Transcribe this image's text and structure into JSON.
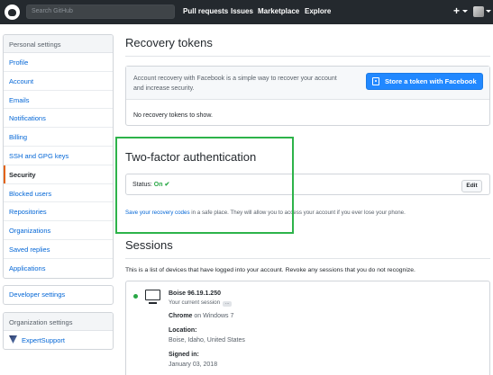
{
  "header": {
    "search_placeholder": "Search GitHub",
    "nav": [
      "Pull requests",
      "Issues",
      "Marketplace",
      "Explore"
    ],
    "plus": "+"
  },
  "sidebar": {
    "personal_heading": "Personal settings",
    "items": [
      {
        "label": "Profile"
      },
      {
        "label": "Account"
      },
      {
        "label": "Emails"
      },
      {
        "label": "Notifications"
      },
      {
        "label": "Billing"
      },
      {
        "label": "SSH and GPG keys"
      },
      {
        "label": "Security",
        "selected": true
      },
      {
        "label": "Blocked users"
      },
      {
        "label": "Repositories"
      },
      {
        "label": "Organizations"
      },
      {
        "label": "Saved replies"
      },
      {
        "label": "Applications"
      }
    ],
    "developer_settings": "Developer settings",
    "org_heading": "Organization settings",
    "org_item": "ExpertSupport"
  },
  "recovery": {
    "title": "Recovery tokens",
    "desc_line1": "Account recovery with Facebook is a simple way to recover your account",
    "desc_line2": "and increase security.",
    "button": "Store a token with Facebook",
    "empty": "No recovery tokens to show."
  },
  "two_factor": {
    "title": "Two-factor authentication",
    "status_label": "Status:",
    "status_value": "On",
    "check": "✔",
    "edit": "Edit",
    "codes_link": "Save your recovery codes",
    "codes_rest": " in a safe place. They will allow you to access your account if you ever lose your phone."
  },
  "sessions": {
    "title": "Sessions",
    "desc": "This is a list of devices that have logged into your account. Revoke any sessions that you do not recognize.",
    "session": {
      "location_ip": "Boise 96.19.1.250",
      "current": "Your current session",
      "more": "…",
      "browser": "Chrome",
      "os_text": " on Windows 7",
      "location_label": "Location:",
      "location_value": "Boise, Idaho, United States",
      "signed_label": "Signed in:",
      "signed_value": "January 03, 2018"
    }
  },
  "colors": {
    "header_bg": "#24292e",
    "link": "#0366d6",
    "selected_indicator": "#e36209",
    "status_on": "#28a745",
    "facebook_button": "#2188ff",
    "highlight_border": "#2db34a"
  }
}
